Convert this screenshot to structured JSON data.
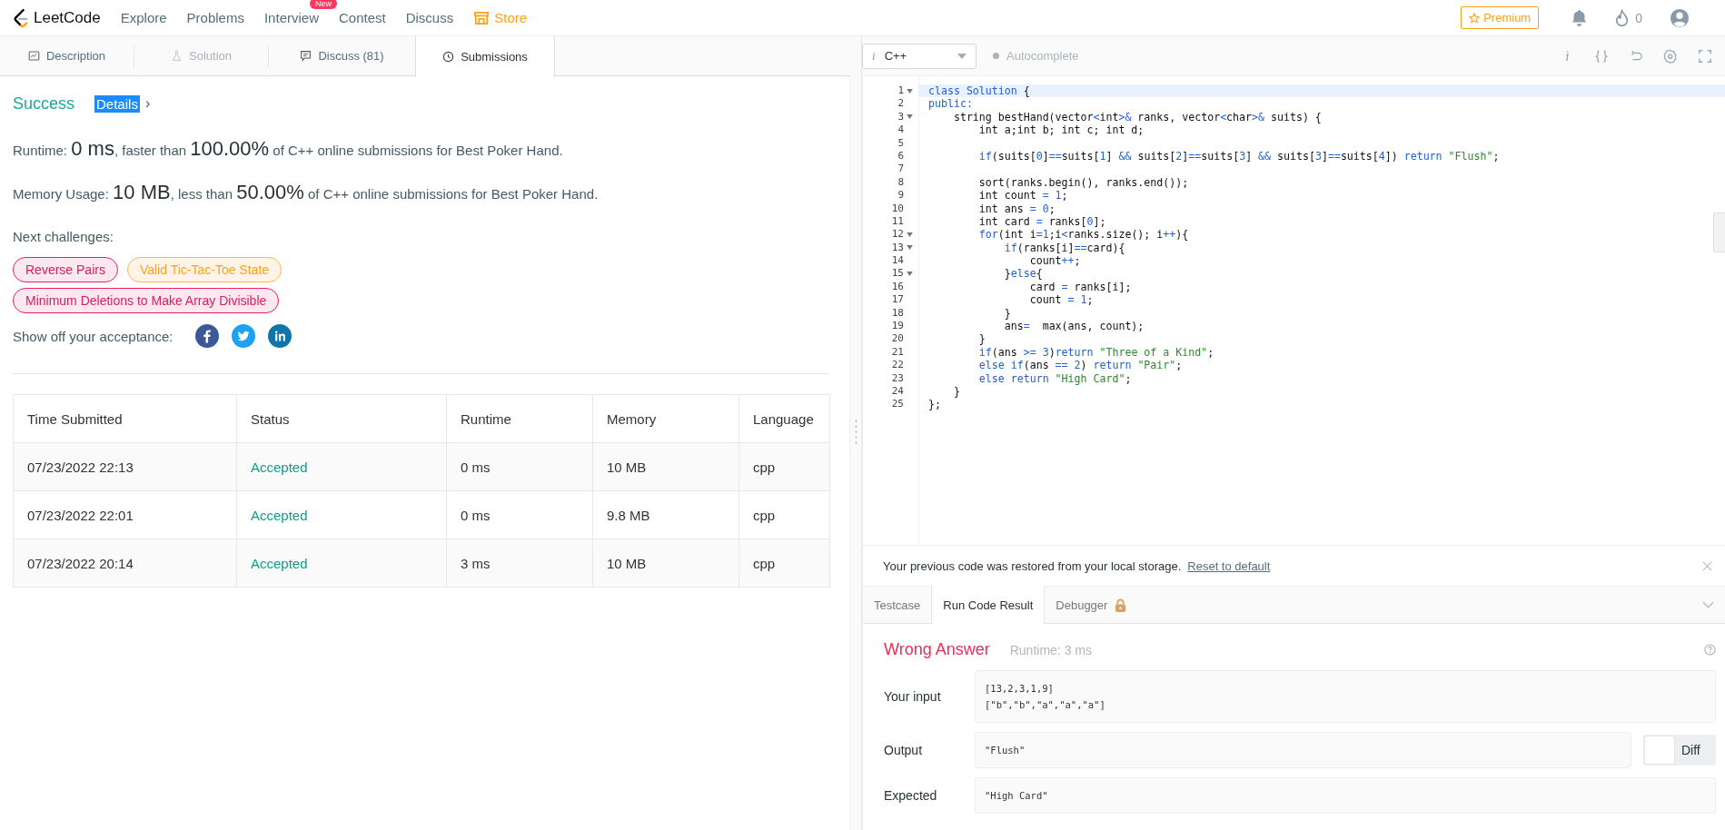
{
  "nav": {
    "logo": "LeetCode",
    "items": [
      {
        "label": "Explore",
        "store": false
      },
      {
        "label": "Problems",
        "store": false
      },
      {
        "label": "Interview",
        "badge": "New",
        "store": false
      },
      {
        "label": "Contest",
        "store": false
      },
      {
        "label": "Discuss",
        "store": false
      },
      {
        "label": "Store",
        "store": true
      }
    ],
    "premium": "Premium",
    "streak": "0"
  },
  "tabs": [
    {
      "label": "Description",
      "selected": false,
      "disabled": false
    },
    {
      "label": "Solution",
      "selected": false,
      "disabled": true
    },
    {
      "label": "Discuss (81)",
      "selected": false,
      "disabled": false
    },
    {
      "label": "Submissions",
      "selected": true,
      "disabled": false
    }
  ],
  "result": {
    "status": "Success",
    "details": {
      "label": "Details",
      "highlighted": true,
      "arrow": "›"
    },
    "stats": [
      [
        {
          "text": "Runtime: ",
          "big": false
        },
        {
          "text": "0 ms",
          "big": true
        },
        {
          "text": ", faster than ",
          "big": false
        },
        {
          "text": "100.00%",
          "big": true
        },
        {
          "text": " of C++ online submissions for Best Poker Hand.",
          "big": false
        }
      ],
      [
        {
          "text": "Memory Usage: ",
          "big": false
        },
        {
          "text": "10 MB",
          "big": true
        },
        {
          "text": ", less than ",
          "big": false
        },
        {
          "text": "50.00%",
          "big": true
        },
        {
          "text": " of C++ online submissions for Best Poker Hand.",
          "big": false
        }
      ]
    ],
    "challenges_label": "Next challenges:",
    "challenges": [
      {
        "label": "Reverse Pairs",
        "kind": "hard"
      },
      {
        "label": "Valid Tic-Tac-Toe State",
        "kind": "medium"
      },
      {
        "label": "Minimum Deletions to Make Array Divisible",
        "kind": "hard"
      }
    ],
    "share_label": "Show off your acceptance:",
    "share": [
      {
        "kind": "facebook"
      },
      {
        "kind": "twitter"
      },
      {
        "kind": "linkedin"
      }
    ]
  },
  "table": {
    "columns": [
      "Time Submitted",
      "Status",
      "Runtime",
      "Memory",
      "Language"
    ],
    "rows": [
      [
        "07/23/2022 22:13",
        "Accepted",
        "0 ms",
        "10 MB",
        "cpp"
      ],
      [
        "07/23/2022 22:01",
        "Accepted",
        "0 ms",
        "9.8 MB",
        "cpp"
      ],
      [
        "07/23/2022 20:14",
        "Accepted",
        "3 ms",
        "10 MB",
        "cpp"
      ]
    ]
  },
  "editor": {
    "language": "C++",
    "language_icon": "i",
    "autocomplete": {
      "label": "Autocomplete",
      "on": false
    },
    "lines": [
      {
        "number": "1",
        "fold": true,
        "active": true,
        "tokens": [
          {
            "kind": "kw",
            "text": "class Solution"
          },
          {
            "kind": "plain",
            "text": " {"
          }
        ]
      },
      {
        "number": "2",
        "fold": false,
        "active": false,
        "tokens": [
          {
            "kind": "kw",
            "text": "public:"
          }
        ]
      },
      {
        "number": "3",
        "fold": true,
        "active": false,
        "tokens": [
          {
            "kind": "plain",
            "text": "    string bestHand(vector"
          },
          {
            "kind": "kw",
            "text": "<"
          },
          {
            "kind": "plain",
            "text": "int"
          },
          {
            "kind": "kw",
            "text": ">&"
          },
          {
            "kind": "plain",
            "text": " ranks, vector"
          },
          {
            "kind": "kw",
            "text": "<"
          },
          {
            "kind": "plain",
            "text": "char"
          },
          {
            "kind": "kw",
            "text": ">&"
          },
          {
            "kind": "plain",
            "text": " suits) {"
          }
        ]
      },
      {
        "number": "4",
        "fold": false,
        "active": false,
        "tokens": [
          {
            "kind": "plain",
            "text": "        int a;int b; int c; int d;"
          }
        ]
      },
      {
        "number": "5",
        "fold": false,
        "active": false
      },
      {
        "number": "6",
        "fold": false,
        "active": false,
        "tokens": [
          {
            "kind": "kw",
            "text": "        if"
          },
          {
            "kind": "plain",
            "text": "(suits["
          },
          {
            "kind": "kw",
            "text": "0"
          },
          {
            "kind": "plain",
            "text": "]"
          },
          {
            "kind": "kw",
            "text": "=="
          },
          {
            "kind": "plain",
            "text": "suits["
          },
          {
            "kind": "kw",
            "text": "1"
          },
          {
            "kind": "plain",
            "text": "] "
          },
          {
            "kind": "kw",
            "text": "&&"
          },
          {
            "kind": "plain",
            "text": " suits["
          },
          {
            "kind": "kw",
            "text": "2"
          },
          {
            "kind": "plain",
            "text": "]"
          },
          {
            "kind": "kw",
            "text": "=="
          },
          {
            "kind": "plain",
            "text": "suits["
          },
          {
            "kind": "kw",
            "text": "3"
          },
          {
            "kind": "plain",
            "text": "] "
          },
          {
            "kind": "kw",
            "text": "&&"
          },
          {
            "kind": "plain",
            "text": " suits["
          },
          {
            "kind": "kw",
            "text": "3"
          },
          {
            "kind": "plain",
            "text": "]"
          },
          {
            "kind": "kw",
            "text": "=="
          },
          {
            "kind": "plain",
            "text": "suits["
          },
          {
            "kind": "kw",
            "text": "4"
          },
          {
            "kind": "plain",
            "text": "]) "
          },
          {
            "kind": "kw",
            "text": "return "
          },
          {
            "kind": "str",
            "text": "\"Flush\""
          },
          {
            "kind": "plain",
            "text": ";"
          }
        ]
      },
      {
        "number": "7",
        "fold": false,
        "active": false
      },
      {
        "number": "8",
        "fold": false,
        "active": false,
        "tokens": [
          {
            "kind": "plain",
            "text": "        sort(ranks.begin(), ranks.end());"
          }
        ]
      },
      {
        "number": "9",
        "fold": false,
        "active": false,
        "tokens": [
          {
            "kind": "plain",
            "text": "        int count "
          },
          {
            "kind": "kw",
            "text": "= 1"
          },
          {
            "kind": "plain",
            "text": ";"
          }
        ]
      },
      {
        "number": "10",
        "fold": false,
        "active": false,
        "tokens": [
          {
            "kind": "plain",
            "text": "        int ans "
          },
          {
            "kind": "kw",
            "text": "= 0"
          },
          {
            "kind": "plain",
            "text": ";"
          }
        ]
      },
      {
        "number": "11",
        "fold": false,
        "active": false,
        "tokens": [
          {
            "kind": "plain",
            "text": "        int card "
          },
          {
            "kind": "kw",
            "text": "="
          },
          {
            "kind": "plain",
            "text": " ranks["
          },
          {
            "kind": "kw",
            "text": "0"
          },
          {
            "kind": "plain",
            "text": "];"
          }
        ]
      },
      {
        "number": "12",
        "fold": true,
        "active": false,
        "tokens": [
          {
            "kind": "kw",
            "text": "        for"
          },
          {
            "kind": "plain",
            "text": "(int i"
          },
          {
            "kind": "kw",
            "text": "=1"
          },
          {
            "kind": "plain",
            "text": ";i"
          },
          {
            "kind": "kw",
            "text": "<"
          },
          {
            "kind": "plain",
            "text": "ranks.size(); i"
          },
          {
            "kind": "kw",
            "text": "++"
          },
          {
            "kind": "plain",
            "text": "){"
          }
        ]
      },
      {
        "number": "13",
        "fold": true,
        "active": false,
        "tokens": [
          {
            "kind": "kw",
            "text": "            if"
          },
          {
            "kind": "plain",
            "text": "(ranks[i]"
          },
          {
            "kind": "kw",
            "text": "=="
          },
          {
            "kind": "plain",
            "text": "card){"
          }
        ]
      },
      {
        "number": "14",
        "fold": false,
        "active": false,
        "tokens": [
          {
            "kind": "plain",
            "text": "                count"
          },
          {
            "kind": "kw",
            "text": "++"
          },
          {
            "kind": "plain",
            "text": ";"
          }
        ]
      },
      {
        "number": "15",
        "fold": true,
        "active": false,
        "tokens": [
          {
            "kind": "plain",
            "text": "            }"
          },
          {
            "kind": "kw",
            "text": "else"
          },
          {
            "kind": "plain",
            "text": "{"
          }
        ]
      },
      {
        "number": "16",
        "fold": false,
        "active": false,
        "tokens": [
          {
            "kind": "plain",
            "text": "                card "
          },
          {
            "kind": "kw",
            "text": "="
          },
          {
            "kind": "plain",
            "text": " ranks[i];"
          }
        ]
      },
      {
        "number": "17",
        "fold": false,
        "active": false,
        "tokens": [
          {
            "kind": "plain",
            "text": "                count "
          },
          {
            "kind": "kw",
            "text": "= 1"
          },
          {
            "kind": "plain",
            "text": ";"
          }
        ]
      },
      {
        "number": "18",
        "fold": false,
        "active": false,
        "tokens": [
          {
            "kind": "plain",
            "text": "            }"
          }
        ]
      },
      {
        "number": "19",
        "fold": false,
        "active": false,
        "tokens": [
          {
            "kind": "plain",
            "text": "            ans"
          },
          {
            "kind": "kw",
            "text": "="
          },
          {
            "kind": "plain",
            "text": "  max(ans, count);"
          }
        ]
      },
      {
        "number": "20",
        "fold": false,
        "active": false,
        "tokens": [
          {
            "kind": "plain",
            "text": "        }"
          }
        ]
      },
      {
        "number": "21",
        "fold": false,
        "active": false,
        "tokens": [
          {
            "kind": "kw",
            "text": "        if"
          },
          {
            "kind": "plain",
            "text": "(ans "
          },
          {
            "kind": "kw",
            "text": ">= 3"
          },
          {
            "kind": "plain",
            "text": ")"
          },
          {
            "kind": "kw",
            "text": "return "
          },
          {
            "kind": "str",
            "text": "\"Three of a Kind\""
          },
          {
            "kind": "plain",
            "text": ";"
          }
        ]
      },
      {
        "number": "22",
        "fold": false,
        "active": false,
        "tokens": [
          {
            "kind": "kw",
            "text": "        else if"
          },
          {
            "kind": "plain",
            "text": "(ans "
          },
          {
            "kind": "kw",
            "text": "== 2"
          },
          {
            "kind": "plain",
            "text": ") "
          },
          {
            "kind": "kw",
            "text": "return "
          },
          {
            "kind": "str",
            "text": "\"Pair\""
          },
          {
            "kind": "plain",
            "text": ";"
          }
        ]
      },
      {
        "number": "23",
        "fold": false,
        "active": false,
        "tokens": [
          {
            "kind": "kw",
            "text": "        else return "
          },
          {
            "kind": "str",
            "text": "\"High Card\""
          },
          {
            "kind": "plain",
            "text": ";"
          }
        ]
      },
      {
        "number": "24",
        "fold": false,
        "active": false,
        "tokens": [
          {
            "kind": "plain",
            "text": "    }"
          }
        ]
      },
      {
        "number": "25",
        "fold": false,
        "active": false,
        "tokens": [
          {
            "kind": "plain",
            "text": "};"
          }
        ]
      }
    ]
  },
  "notice": {
    "text": "Your previous code was restored from your local storage.",
    "link": "Reset to default"
  },
  "console": {
    "tabs": [
      {
        "label": "Testcase",
        "selected": false,
        "locked": false
      },
      {
        "label": "Run Code Result",
        "selected": true,
        "locked": false
      },
      {
        "label": "Debugger",
        "selected": false,
        "locked": true
      }
    ],
    "verdict": "Wrong Answer",
    "runtime": "Runtime: 3 ms",
    "fields": [
      {
        "label": "Your input",
        "lines": [
          "[13,2,3,1,9]",
          "[\"b\",\"b\",\"a\",\"a\",\"a\"]"
        ],
        "diff": false
      },
      {
        "label": "Output",
        "lines": [
          "\"Flush\""
        ],
        "diff": true
      },
      {
        "label": "Expected",
        "lines": [
          "\"High Card\""
        ],
        "diff": false
      }
    ],
    "diff": {
      "label": "Diff",
      "on": false
    }
  }
}
